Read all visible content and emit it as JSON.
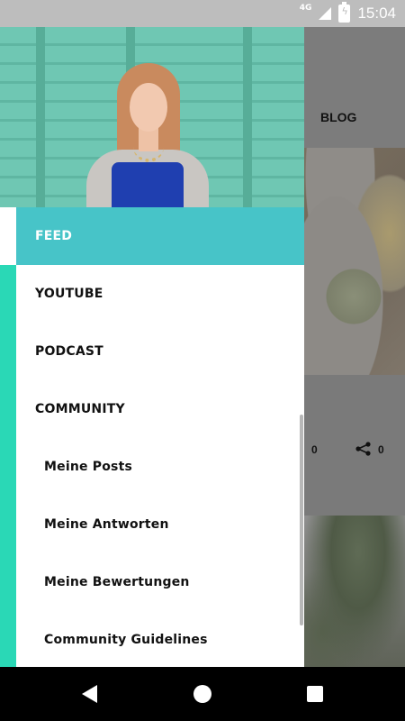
{
  "status_bar": {
    "network": "4G",
    "time": "15:04"
  },
  "background_app": {
    "tab_label": "BLOG",
    "likes_count": "0",
    "shares_count": "0"
  },
  "drawer": {
    "items": [
      {
        "label": "FEED",
        "active": true
      },
      {
        "label": "YOUTUBE"
      },
      {
        "label": "PODCAST"
      },
      {
        "label": "COMMUNITY"
      },
      {
        "label": "Meine Posts",
        "sub": true
      },
      {
        "label": "Meine Antworten",
        "sub": true
      },
      {
        "label": "Meine Bewertungen",
        "sub": true
      },
      {
        "label": "Community Guidelines",
        "sub": true
      }
    ]
  },
  "colors": {
    "active_item": "#47c4c8",
    "accent_bar": "#2ad8b6"
  },
  "icons": {
    "back": "back-icon",
    "home": "home-icon",
    "recents": "recents-icon",
    "share": "share-icon"
  }
}
